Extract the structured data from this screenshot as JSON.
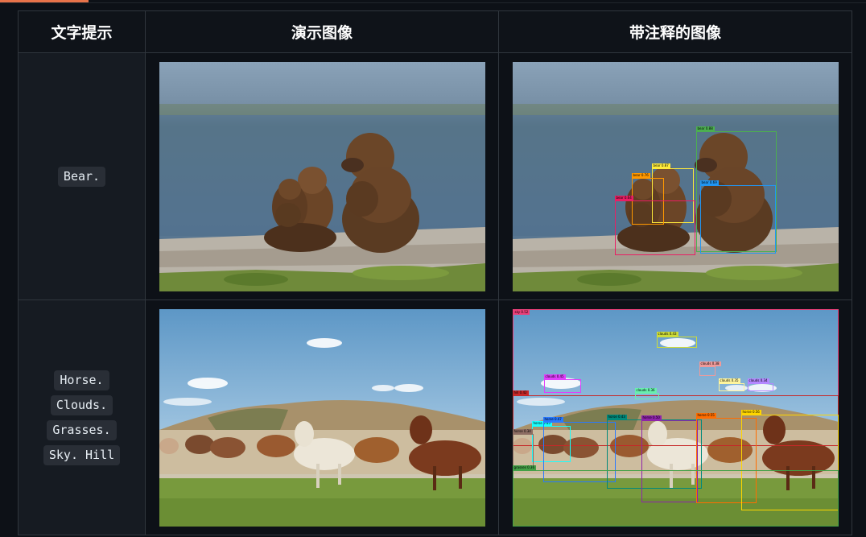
{
  "table": {
    "headers": {
      "prompt": "文字提示",
      "demo": "演示图像",
      "annotated": "带注释的图像"
    },
    "rows": [
      {
        "prompts": [
          "Bear."
        ],
        "demo_image": "bear-family-by-lake-photo",
        "annotated_image": "bear-family-with-detection-boxes",
        "detections": [
          {
            "label": "bear 0.88",
            "color": "#4caf50"
          },
          {
            "label": "bear 0.87",
            "color": "#ffeb3b"
          },
          {
            "label": "bear 0.76",
            "color": "#ff9800"
          },
          {
            "label": "bear 0.69",
            "color": "#2196f3"
          },
          {
            "label": "bear 0.64",
            "color": "#e91e63"
          }
        ]
      },
      {
        "prompts": [
          "Horse.",
          "Clouds.",
          "Grasses.",
          "Sky. Hill"
        ],
        "demo_image": "wild-horses-running-photo",
        "annotated_image": "wild-horses-with-detection-boxes",
        "detections": [
          {
            "label": "clouds 0.43",
            "color": "#cddc39"
          },
          {
            "label": "clouds 0.45",
            "color": "#e040fb"
          },
          {
            "label": "clouds 0.38",
            "color": "#ef9a9a"
          },
          {
            "label": "clouds 0.36",
            "color": "#69f0ae"
          },
          {
            "label": "clouds 0.35",
            "color": "#fff59d"
          },
          {
            "label": "clouds 0.34",
            "color": "#b388ff"
          },
          {
            "label": "horse 0.45",
            "color": "#18ffff"
          },
          {
            "label": "horse 0.47",
            "color": "#2979ff"
          },
          {
            "label": "horse 0.43",
            "color": "#00897b"
          },
          {
            "label": "horse 0.50",
            "color": "#8e24aa"
          },
          {
            "label": "horse 0.55",
            "color": "#ff6d00"
          },
          {
            "label": "horse 0.56",
            "color": "#ffd600"
          },
          {
            "label": "horse 0.34",
            "color": "#8d6e63"
          },
          {
            "label": "grasses 0.36",
            "color": "#43a047"
          },
          {
            "label": "hill 0.42",
            "color": "#c62828"
          },
          {
            "label": "sky 0.52",
            "color": "#ec407a"
          }
        ]
      }
    ]
  },
  "colors": {
    "background": "#0d1117",
    "border": "#30363d",
    "chip": "#292e36",
    "accent": "#e8734a"
  }
}
